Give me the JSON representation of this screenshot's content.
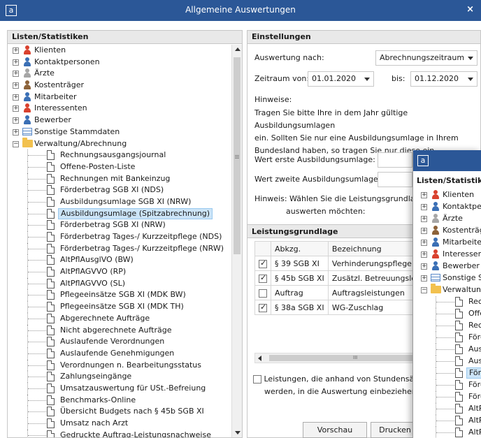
{
  "window": {
    "title": "Allgemeine Auswertungen",
    "logo": "a",
    "close": "×"
  },
  "left_panel": {
    "header": "Listen/Statistiken",
    "top_items": [
      {
        "label": "Klienten",
        "icon": "person-red-icon"
      },
      {
        "label": "Kontaktpersonen",
        "icon": "persons-blue-icon"
      },
      {
        "label": "Ärzte",
        "icon": "person-gray-icon"
      },
      {
        "label": "Kostenträger",
        "icon": "persons-brown-icon"
      },
      {
        "label": "Mitarbeiter",
        "icon": "person-blue-icon"
      },
      {
        "label": "Interessenten",
        "icon": "person-question-icon"
      },
      {
        "label": "Bewerber",
        "icon": "person-question-blue-icon"
      },
      {
        "label": "Sonstige Stammdaten",
        "icon": "table-icon"
      },
      {
        "label": "Verwaltung/Abrechnung",
        "icon": "folder-icon"
      }
    ],
    "children": [
      "Rechnungsausgangsjournal",
      "Offene-Posten-Liste",
      "Rechnungen mit Bankeinzug",
      "Förderbetrag SGB XI (NDS)",
      "Ausbildungsumlage SGB XI (NRW)",
      "Ausbildungsumlage (Spitzabrechnung)",
      "Förderbetrag SGB XI (NRW)",
      "Förderbetrag Tages-/ Kurzzeitpflege (NDS)",
      "Förderbetrag Tages-/ Kurzzeitpflege (NRW)",
      "AltPflAusglVO (BW)",
      "AltPflAGVVO (RP)",
      "AltPflAGVVO (SL)",
      "Pflegeeinsätze SGB XI (MDK BW)",
      "Pflegeeinsätze SGB XI (MDK TH)",
      "Abgerechnete Aufträge",
      "Nicht abgerechnete Aufträge",
      "Auslaufende Verordnungen",
      "Auslaufende Genehmigungen",
      "Verordnungen n. Bearbeitungsstatus",
      "Zahlungseingänge",
      "Umsatzauswertung für USt.-Befreiung",
      "Benchmarks-Online",
      "Übersicht Budgets nach § 45b SGB XI",
      "Umsatz nach Arzt",
      "Gedruckte Auftrag-Leistungsnachweise"
    ],
    "selected_child": "Ausbildungsumlage (Spitzabrechnung)"
  },
  "settings": {
    "header": "Einstellungen",
    "auswertung_label": "Auswertung nach:",
    "auswertung_value": "Abrechnungszeitraum",
    "zeitraum_label": "Zeitraum von:",
    "zeitraum_from": "01.01.2020",
    "bis_label": "bis:",
    "zeitraum_to": "01.12.2020",
    "hinweise_label": "Hinweise:",
    "hinweise_text_1": "Tragen Sie bitte Ihre in dem Jahr gültige Ausbildungsumlagen",
    "hinweise_text_2": "ein. Sollten Sie nur eine Ausbildungsumlage in Ihrem",
    "hinweise_text_3": "Bundesland haben, so tragen Sie nur diese ein.",
    "wert_erste_label": "Wert erste Ausbildungsumlage:",
    "wert_zweite_label": "Wert zweite Ausbildungsumlage:",
    "hinweis_waehlen_1": "Hinweis: Wählen Sie die Leistungsgrundlagen",
    "hinweis_waehlen_2": "auswerten möchten:"
  },
  "grid": {
    "header": "Leistungsgrundlage",
    "columns": [
      "Abkzg.",
      "Bezeichnung"
    ],
    "rows": [
      {
        "checked": true,
        "abkzg": "§ 39 SGB XI",
        "bezeichnung": "Verhinderungspflege"
      },
      {
        "checked": true,
        "abkzg": "§ 45b SGB XI",
        "bezeichnung": "Zusätzl. Betreuungsleistun"
      },
      {
        "checked": false,
        "abkzg": "Auftrag",
        "bezeichnung": "Auftragsleistungen"
      },
      {
        "checked": true,
        "abkzg": "§ 38a SGB XI",
        "bezeichnung": "WG-Zuschlag"
      }
    ],
    "hscroll_grip": "III"
  },
  "bottom_note": {
    "line1": "Leistungen, die anhand von Stundensätzen",
    "line2": "werden, in die Auswertung einbeziehen",
    "checked": false
  },
  "buttons": {
    "vorschau": "Vorschau",
    "drucken": "Drucken"
  },
  "overlay": {
    "logo": "a",
    "header": "Listen/Statistiken",
    "top_items": [
      "Klienten",
      "Kontaktpersonen",
      "Ärzte",
      "Kostenträger",
      "Mitarbeiter",
      "Interessenten",
      "Bewerber",
      "Sonstige Stammdaten",
      "Verwaltung/Abrechnung"
    ],
    "children": [
      "Rechnungsausgangsjournal",
      "Offene-Posten-Liste",
      "Rechnungen mit Bankeinzug",
      "Förderbetrag SGB XI (NDS)",
      "Ausbildungsumlage SGB XI (NRW)",
      "Ausbildungsumlage (Spitzabrechnung)",
      "Förderbetrag SGB XI (NRW)",
      "Förderbetrag Tages-/ Kurzzeitpflege (NDS)",
      "Förderbetrag Tages-/ Kurzzeitpflege (NRW)",
      "AltPflAusglVO (BW)",
      "AltPflAGVVO (RP)",
      "AltPflAGVVO (SL)"
    ],
    "selected_child": "Förderbetrag SGB XI (NRW)"
  },
  "colors": {
    "titlebar": "#2b5797",
    "selection": "#cce4f7"
  }
}
